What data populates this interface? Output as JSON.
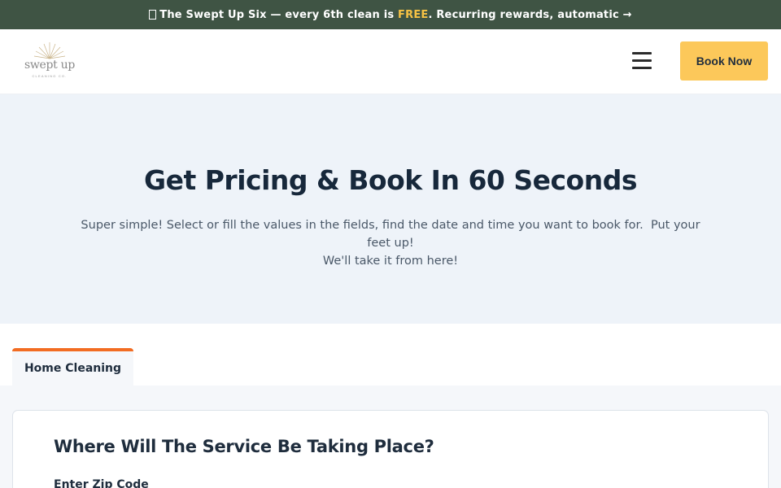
{
  "promo": {
    "gift_icon": "gift-icon",
    "text_before": "The Swept Up Six — every 6th clean is ",
    "highlight": "FREE",
    "text_after": ". Recurring rewards, automatic →",
    "highlight_color": "#f6c244",
    "background": "#3f5444"
  },
  "header": {
    "logo_text": "swept up",
    "logo_subtext": "CLEANING CO.",
    "menu_icon": "hamburger-menu-icon",
    "book_label": "Book Now",
    "book_color": "#fcc85a"
  },
  "hero": {
    "title": "Get Pricing & Book In 60 Seconds",
    "subtitle_line1": "Super simple! Select or fill the values in the fields, find the date and time you want to book for.  Put your feet up!",
    "subtitle_line2": "We'll take it from here!"
  },
  "tabs": [
    {
      "label": "Home Cleaning",
      "active": true,
      "accent": "#f26c22"
    }
  ],
  "form": {
    "section_title": "Where Will The Service Be Taking Place?",
    "zip_label": "Enter Zip Code"
  }
}
